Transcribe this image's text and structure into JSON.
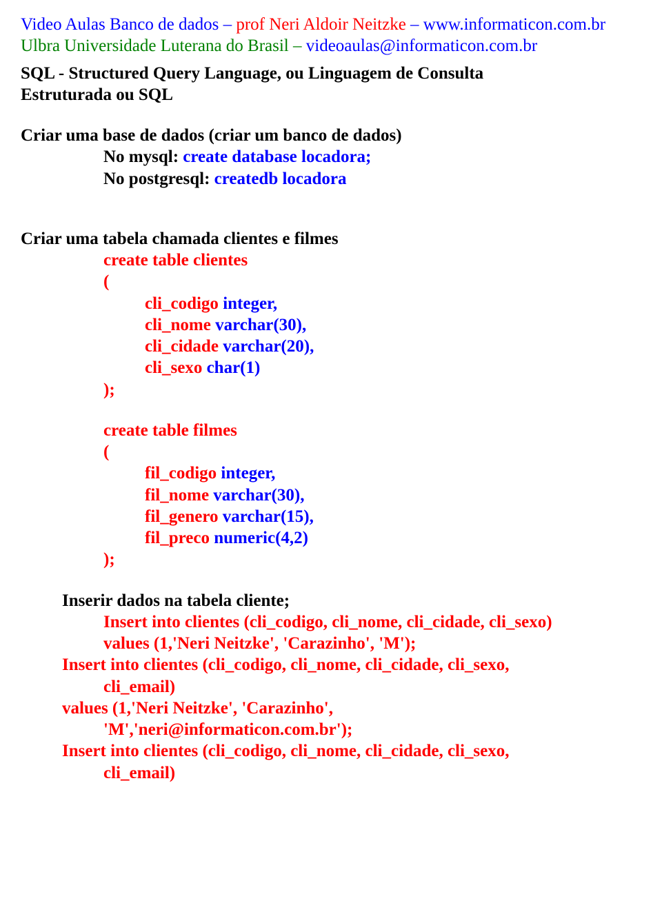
{
  "header": {
    "line1_a": "Video Aulas Banco de dados – ",
    "line1_b": "prof Neri Aldoir Neitzke",
    "line1_c": " – ",
    "line1_d": "www.informaticon.com.br",
    "line2_a": "Ulbra Universidade Luterana do Brasil – ",
    "line2_b": "videoaulas@informaticon.com.br"
  },
  "title": {
    "l1": "SQL - Structured Query Language, ou Linguagem de Consulta",
    "l2": "Estruturada ou SQL"
  },
  "criar_base": {
    "heading": "Criar uma base de dados (criar um banco de dados)",
    "mysql_a": "No mysql: ",
    "mysql_b": " create database locadora;",
    "pg_a": "No postgresql: ",
    "pg_b": " createdb locadora"
  },
  "criar_tabela": {
    "heading": "Criar uma tabela chamada clientes e filmes",
    "clientes": {
      "l1": "create table clientes",
      "l2": "(",
      "c1a": "cli_codigo",
      "c1b": "  integer,",
      "c2a": "cli_nome",
      "c2b": "    varchar(30),",
      "c3a": "cli_cidade",
      "c3b": " varchar(20),",
      "c4a": "cli_sexo",
      "c4b": "     char(1)",
      "end": ");"
    },
    "filmes": {
      "l1": "create table filmes",
      "l2": "(",
      "c1a": "fil_codigo",
      "c1b": "  integer,",
      "c2a": "fil_nome",
      "c2b": "    varchar(30),",
      "c3a": "fil_genero",
      "c3b": " varchar(15),",
      "c4a": "fil_preco",
      "c4b": "    numeric(4,2)",
      "end": ");"
    }
  },
  "inserir": {
    "heading": "Inserir dados na tabela cliente;",
    "l1": " Insert into clientes (cli_codigo, cli_nome, cli_cidade, cli_sexo)",
    "l2": "values (1,'Neri Neitzke', 'Carazinho', 'M');",
    "l3": "Insert into clientes (cli_codigo, cli_nome, cli_cidade, cli_sexo,",
    "l4": "cli_email)",
    "l5": "values (1,'Neri Neitzke', 'Carazinho',",
    "l6": "'M','neri@informaticon.com.br');",
    "l7": "Insert into clientes (cli_codigo, cli_nome, cli_cidade, cli_sexo,",
    "l8": "cli_email)"
  }
}
